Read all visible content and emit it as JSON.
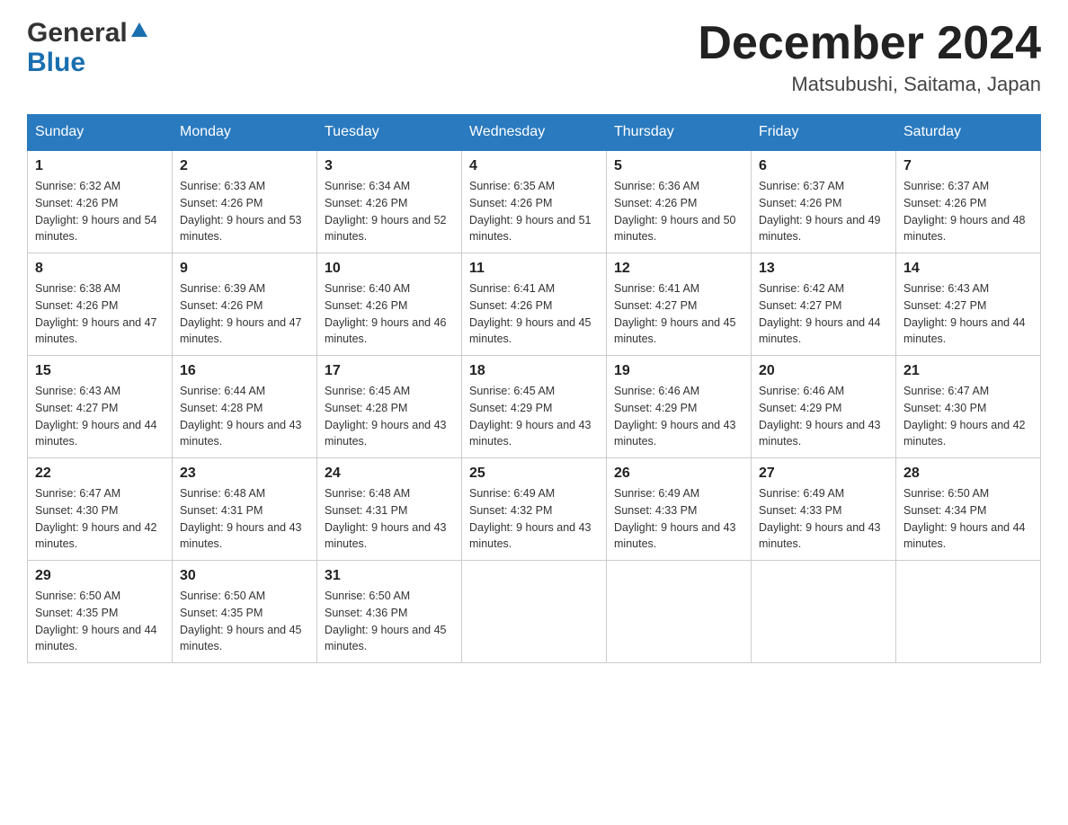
{
  "header": {
    "logo_general": "General",
    "logo_blue": "Blue",
    "month_title": "December 2024",
    "location": "Matsubushi, Saitama, Japan"
  },
  "days_of_week": [
    "Sunday",
    "Monday",
    "Tuesday",
    "Wednesday",
    "Thursday",
    "Friday",
    "Saturday"
  ],
  "weeks": [
    [
      {
        "day": "1",
        "sunrise": "6:32 AM",
        "sunset": "4:26 PM",
        "daylight": "9 hours and 54 minutes."
      },
      {
        "day": "2",
        "sunrise": "6:33 AM",
        "sunset": "4:26 PM",
        "daylight": "9 hours and 53 minutes."
      },
      {
        "day": "3",
        "sunrise": "6:34 AM",
        "sunset": "4:26 PM",
        "daylight": "9 hours and 52 minutes."
      },
      {
        "day": "4",
        "sunrise": "6:35 AM",
        "sunset": "4:26 PM",
        "daylight": "9 hours and 51 minutes."
      },
      {
        "day": "5",
        "sunrise": "6:36 AM",
        "sunset": "4:26 PM",
        "daylight": "9 hours and 50 minutes."
      },
      {
        "day": "6",
        "sunrise": "6:37 AM",
        "sunset": "4:26 PM",
        "daylight": "9 hours and 49 minutes."
      },
      {
        "day": "7",
        "sunrise": "6:37 AM",
        "sunset": "4:26 PM",
        "daylight": "9 hours and 48 minutes."
      }
    ],
    [
      {
        "day": "8",
        "sunrise": "6:38 AM",
        "sunset": "4:26 PM",
        "daylight": "9 hours and 47 minutes."
      },
      {
        "day": "9",
        "sunrise": "6:39 AM",
        "sunset": "4:26 PM",
        "daylight": "9 hours and 47 minutes."
      },
      {
        "day": "10",
        "sunrise": "6:40 AM",
        "sunset": "4:26 PM",
        "daylight": "9 hours and 46 minutes."
      },
      {
        "day": "11",
        "sunrise": "6:41 AM",
        "sunset": "4:26 PM",
        "daylight": "9 hours and 45 minutes."
      },
      {
        "day": "12",
        "sunrise": "6:41 AM",
        "sunset": "4:27 PM",
        "daylight": "9 hours and 45 minutes."
      },
      {
        "day": "13",
        "sunrise": "6:42 AM",
        "sunset": "4:27 PM",
        "daylight": "9 hours and 44 minutes."
      },
      {
        "day": "14",
        "sunrise": "6:43 AM",
        "sunset": "4:27 PM",
        "daylight": "9 hours and 44 minutes."
      }
    ],
    [
      {
        "day": "15",
        "sunrise": "6:43 AM",
        "sunset": "4:27 PM",
        "daylight": "9 hours and 44 minutes."
      },
      {
        "day": "16",
        "sunrise": "6:44 AM",
        "sunset": "4:28 PM",
        "daylight": "9 hours and 43 minutes."
      },
      {
        "day": "17",
        "sunrise": "6:45 AM",
        "sunset": "4:28 PM",
        "daylight": "9 hours and 43 minutes."
      },
      {
        "day": "18",
        "sunrise": "6:45 AM",
        "sunset": "4:29 PM",
        "daylight": "9 hours and 43 minutes."
      },
      {
        "day": "19",
        "sunrise": "6:46 AM",
        "sunset": "4:29 PM",
        "daylight": "9 hours and 43 minutes."
      },
      {
        "day": "20",
        "sunrise": "6:46 AM",
        "sunset": "4:29 PM",
        "daylight": "9 hours and 43 minutes."
      },
      {
        "day": "21",
        "sunrise": "6:47 AM",
        "sunset": "4:30 PM",
        "daylight": "9 hours and 42 minutes."
      }
    ],
    [
      {
        "day": "22",
        "sunrise": "6:47 AM",
        "sunset": "4:30 PM",
        "daylight": "9 hours and 42 minutes."
      },
      {
        "day": "23",
        "sunrise": "6:48 AM",
        "sunset": "4:31 PM",
        "daylight": "9 hours and 43 minutes."
      },
      {
        "day": "24",
        "sunrise": "6:48 AM",
        "sunset": "4:31 PM",
        "daylight": "9 hours and 43 minutes."
      },
      {
        "day": "25",
        "sunrise": "6:49 AM",
        "sunset": "4:32 PM",
        "daylight": "9 hours and 43 minutes."
      },
      {
        "day": "26",
        "sunrise": "6:49 AM",
        "sunset": "4:33 PM",
        "daylight": "9 hours and 43 minutes."
      },
      {
        "day": "27",
        "sunrise": "6:49 AM",
        "sunset": "4:33 PM",
        "daylight": "9 hours and 43 minutes."
      },
      {
        "day": "28",
        "sunrise": "6:50 AM",
        "sunset": "4:34 PM",
        "daylight": "9 hours and 44 minutes."
      }
    ],
    [
      {
        "day": "29",
        "sunrise": "6:50 AM",
        "sunset": "4:35 PM",
        "daylight": "9 hours and 44 minutes."
      },
      {
        "day": "30",
        "sunrise": "6:50 AM",
        "sunset": "4:35 PM",
        "daylight": "9 hours and 45 minutes."
      },
      {
        "day": "31",
        "sunrise": "6:50 AM",
        "sunset": "4:36 PM",
        "daylight": "9 hours and 45 minutes."
      },
      null,
      null,
      null,
      null
    ]
  ]
}
